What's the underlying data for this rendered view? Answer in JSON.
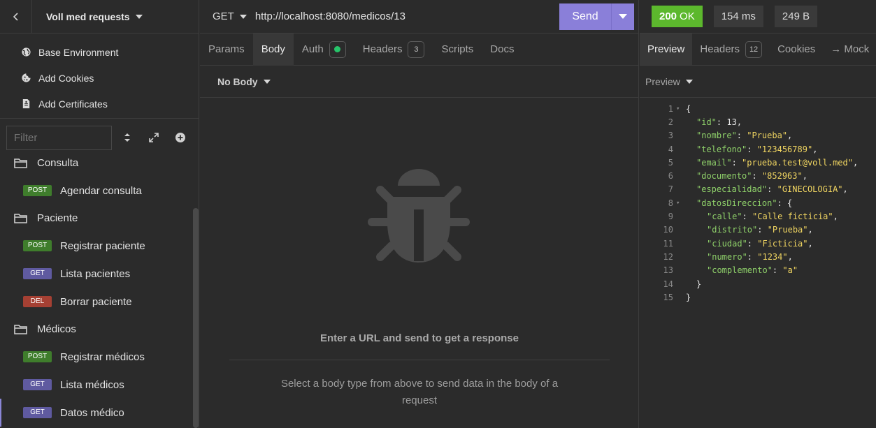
{
  "sidebar": {
    "project_title": "Voll med requests",
    "menu": [
      {
        "label": "Base Environment",
        "icon": "globe-icon"
      },
      {
        "label": "Add Cookies",
        "icon": "cookie-icon"
      },
      {
        "label": "Add Certificates",
        "icon": "certificate-icon"
      }
    ],
    "filter_placeholder": "Filter",
    "tree": [
      {
        "kind": "folder",
        "label": "Consulta"
      },
      {
        "kind": "request",
        "method": "POST",
        "label": "Agendar consulta"
      },
      {
        "kind": "folder",
        "label": "Paciente"
      },
      {
        "kind": "request",
        "method": "POST",
        "label": "Registrar paciente"
      },
      {
        "kind": "request",
        "method": "GET",
        "label": "Lista pacientes"
      },
      {
        "kind": "request",
        "method": "DEL",
        "label": "Borrar paciente"
      },
      {
        "kind": "folder",
        "label": "Médicos"
      },
      {
        "kind": "request",
        "method": "POST",
        "label": "Registrar médicos"
      },
      {
        "kind": "request",
        "method": "GET",
        "label": "Lista médicos"
      },
      {
        "kind": "request",
        "method": "GET",
        "label": "Datos médico",
        "active": true
      }
    ]
  },
  "request": {
    "method": "GET",
    "url": "http://localhost:8080/medicos/13",
    "send_label": "Send",
    "tabs": [
      {
        "label": "Params"
      },
      {
        "label": "Body",
        "active": true
      },
      {
        "label": "Auth",
        "dot": true
      },
      {
        "label": "Headers",
        "count": "3"
      },
      {
        "label": "Scripts"
      },
      {
        "label": "Docs"
      }
    ],
    "body_type": "No Body",
    "empty_title": "Enter a URL and send to get a response",
    "empty_subtitle": "Select a body type from above to send data in the body of a request"
  },
  "response": {
    "status": {
      "code": "200",
      "text": "OK",
      "color": "#5cb82d"
    },
    "time": "154 ms",
    "size": "249 B",
    "tabs": [
      {
        "label": "Preview",
        "active": true
      },
      {
        "label": "Headers",
        "count": "12"
      },
      {
        "label": "Cookies"
      },
      {
        "label": "→ Mock"
      }
    ],
    "preview_label": "Preview",
    "lines": [
      {
        "n": "1",
        "fold": true,
        "indent": 0,
        "parts": [
          [
            "p",
            "{"
          ]
        ]
      },
      {
        "n": "2",
        "indent": 1,
        "parts": [
          [
            "k",
            "\"id\""
          ],
          [
            "p",
            ": "
          ],
          [
            "n",
            "13"
          ],
          [
            "p",
            ","
          ]
        ]
      },
      {
        "n": "3",
        "indent": 1,
        "parts": [
          [
            "k",
            "\"nombre\""
          ],
          [
            "p",
            ": "
          ],
          [
            "s",
            "\"Prueba\""
          ],
          [
            "p",
            ","
          ]
        ]
      },
      {
        "n": "4",
        "indent": 1,
        "parts": [
          [
            "k",
            "\"telefono\""
          ],
          [
            "p",
            ": "
          ],
          [
            "s",
            "\"123456789\""
          ],
          [
            "p",
            ","
          ]
        ]
      },
      {
        "n": "5",
        "indent": 1,
        "parts": [
          [
            "k",
            "\"email\""
          ],
          [
            "p",
            ": "
          ],
          [
            "s",
            "\"prueba.test@voll.med\""
          ],
          [
            "p",
            ","
          ]
        ]
      },
      {
        "n": "6",
        "indent": 1,
        "parts": [
          [
            "k",
            "\"documento\""
          ],
          [
            "p",
            ": "
          ],
          [
            "s",
            "\"852963\""
          ],
          [
            "p",
            ","
          ]
        ]
      },
      {
        "n": "7",
        "indent": 1,
        "parts": [
          [
            "k",
            "\"especialidad\""
          ],
          [
            "p",
            ": "
          ],
          [
            "s",
            "\"GINECOLOGIA\""
          ],
          [
            "p",
            ","
          ]
        ]
      },
      {
        "n": "8",
        "fold": true,
        "indent": 1,
        "parts": [
          [
            "k",
            "\"datosDireccion\""
          ],
          [
            "p",
            ": {"
          ]
        ]
      },
      {
        "n": "9",
        "indent": 2,
        "parts": [
          [
            "k",
            "\"calle\""
          ],
          [
            "p",
            ": "
          ],
          [
            "s",
            "\"Calle ficticia\""
          ],
          [
            "p",
            ","
          ]
        ]
      },
      {
        "n": "10",
        "indent": 2,
        "parts": [
          [
            "k",
            "\"distrito\""
          ],
          [
            "p",
            ": "
          ],
          [
            "s",
            "\"Prueba\""
          ],
          [
            "p",
            ","
          ]
        ]
      },
      {
        "n": "11",
        "indent": 2,
        "parts": [
          [
            "k",
            "\"ciudad\""
          ],
          [
            "p",
            ": "
          ],
          [
            "s",
            "\"Ficticia\""
          ],
          [
            "p",
            ","
          ]
        ]
      },
      {
        "n": "12",
        "indent": 2,
        "parts": [
          [
            "k",
            "\"numero\""
          ],
          [
            "p",
            ": "
          ],
          [
            "s",
            "\"1234\""
          ],
          [
            "p",
            ","
          ]
        ]
      },
      {
        "n": "13",
        "indent": 2,
        "parts": [
          [
            "k",
            "\"complemento\""
          ],
          [
            "p",
            ": "
          ],
          [
            "s",
            "\"a\""
          ]
        ]
      },
      {
        "n": "14",
        "indent": 1,
        "parts": [
          [
            "p",
            "}"
          ]
        ]
      },
      {
        "n": "15",
        "indent": 0,
        "parts": [
          [
            "p",
            "}"
          ]
        ]
      }
    ]
  }
}
